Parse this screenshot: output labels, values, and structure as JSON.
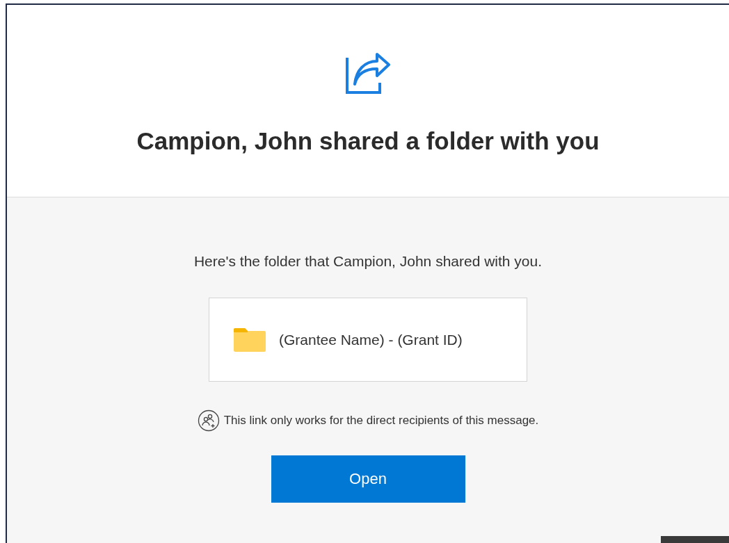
{
  "header": {
    "title": "Campion, John shared a folder with you"
  },
  "body": {
    "message": "Here's the folder that Campion, John shared with you.",
    "folder": {
      "name": "(Grantee Name) - (Grant ID)"
    },
    "notice": "This link only works for the direct recipients of this message.",
    "button": "Open"
  }
}
